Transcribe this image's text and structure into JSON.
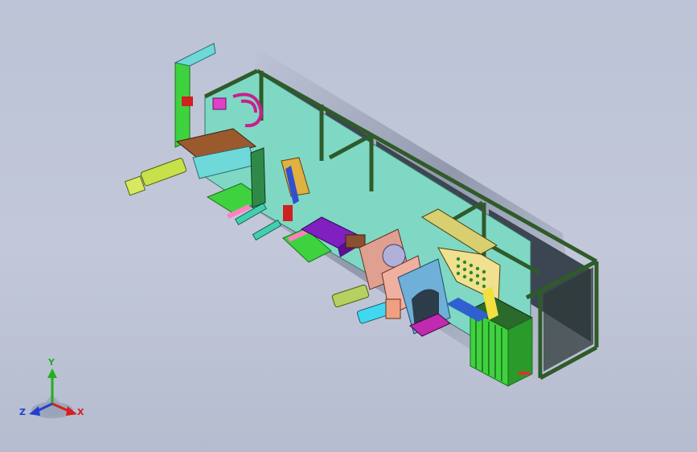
{
  "scene": {
    "background_top": "#bcc3d6",
    "background_bottom": "#b5bccf",
    "frame_color": "#2f5a2a",
    "base_panel_color": "#7fd8c4"
  },
  "triad": {
    "x_label": "X",
    "y_label": "Y",
    "z_label": "Z",
    "x_color": "#d42020",
    "y_color": "#20b020",
    "z_color": "#2040d0"
  }
}
